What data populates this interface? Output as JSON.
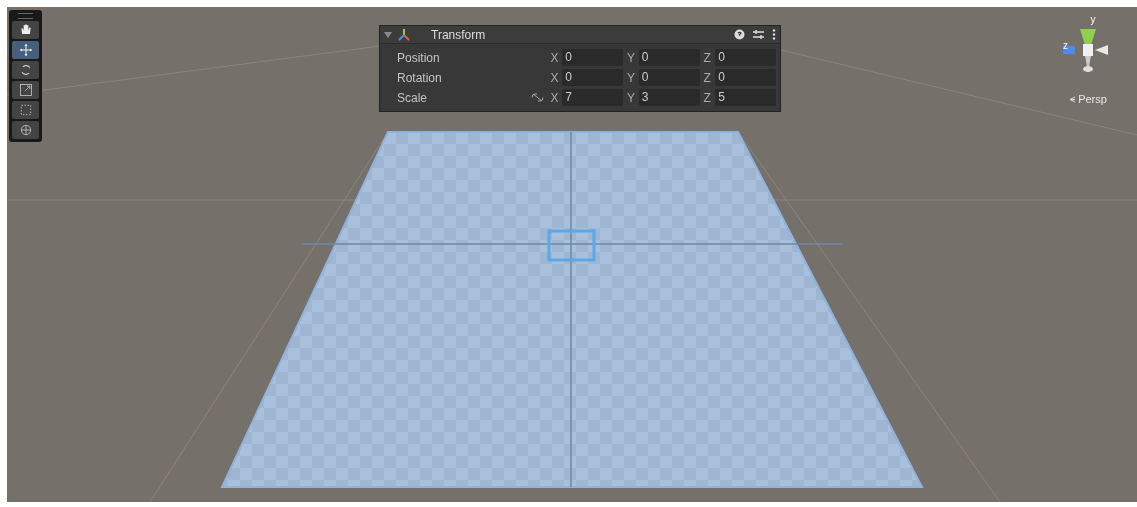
{
  "toolbar": {
    "tools": [
      {
        "kind": "hand",
        "selected": false
      },
      {
        "kind": "move",
        "selected": true
      },
      {
        "kind": "rotate",
        "selected": false
      },
      {
        "kind": "scale",
        "selected": false
      },
      {
        "kind": "rect",
        "selected": false
      },
      {
        "kind": "transform",
        "selected": false
      }
    ]
  },
  "transform_panel": {
    "title": "Transform",
    "expanded": true,
    "rows": [
      {
        "label": "Position",
        "linked": false,
        "fields": [
          {
            "axis": "X",
            "value": "0"
          },
          {
            "axis": "Y",
            "value": "0"
          },
          {
            "axis": "Z",
            "value": "0"
          }
        ]
      },
      {
        "label": "Rotation",
        "linked": false,
        "fields": [
          {
            "axis": "X",
            "value": "0"
          },
          {
            "axis": "Y",
            "value": "0"
          },
          {
            "axis": "Z",
            "value": "0"
          }
        ]
      },
      {
        "label": "Scale",
        "linked": true,
        "fields": [
          {
            "axis": "X",
            "value": "7"
          },
          {
            "axis": "Y",
            "value": "3"
          },
          {
            "axis": "Z",
            "value": "5"
          }
        ]
      }
    ]
  },
  "gizmo": {
    "y_label": "y",
    "z_label": "z",
    "projection": "Persp"
  }
}
